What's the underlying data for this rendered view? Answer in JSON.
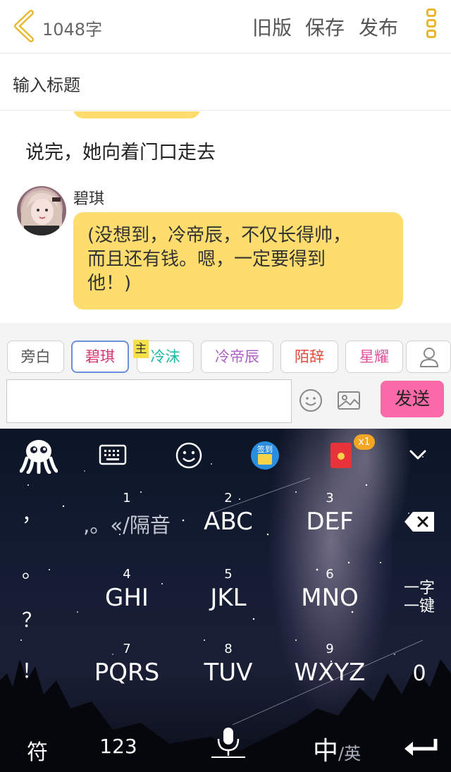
{
  "header": {
    "word_count": "1048字",
    "old_version": "旧版",
    "save": "保存",
    "publish": "发布"
  },
  "title_input": {
    "placeholder": "输入标题"
  },
  "content": {
    "narration": "说完，她向着门口走去",
    "speaker_name": "碧琪",
    "bubble_lines": [
      "(没想到，冷帝辰，不仅长得帅，",
      "而且还有钱。嗯，一定要得到",
      "他！)"
    ]
  },
  "characters": {
    "chips": [
      {
        "label": "旁白",
        "color": "#555555"
      },
      {
        "label": "碧琪",
        "color": "#d6336c"
      },
      {
        "label": "冷沫",
        "color": "#1bb8a5"
      },
      {
        "label": "冷帝辰",
        "color": "#b05fc7"
      },
      {
        "label": "陌辞",
        "color": "#e24b3f"
      },
      {
        "label": "星耀",
        "color": "#e0509b"
      }
    ],
    "main_badge": "主"
  },
  "composer": {
    "send": "发送"
  },
  "keyboard": {
    "toolbar_icons": [
      "octopus-logo-icon",
      "keyboard-icon",
      "emoji-icon",
      "checkin-calendar-icon",
      "red-envelope-icon",
      "chevron-down-icon"
    ],
    "checkin_label": "签到",
    "red_packet_badge": "x1",
    "side_punct": [
      "，",
      "。",
      "？",
      "！"
    ],
    "keys": [
      {
        "num": "1",
        "main": ",。«/隔音"
      },
      {
        "num": "2",
        "main": "ABC"
      },
      {
        "num": "3",
        "main": "DEF"
      },
      {
        "num": "4",
        "main": "GHI"
      },
      {
        "num": "5",
        "main": "JKL"
      },
      {
        "num": "6",
        "main": "MNO"
      },
      {
        "num": "7",
        "main": "PQRS"
      },
      {
        "num": "8",
        "main": "TUV"
      },
      {
        "num": "9",
        "main": "WXYZ"
      }
    ],
    "one_key_line1": "一字",
    "one_key_line2": "一键",
    "zero": "0",
    "symbols": "符",
    "numbers": "123",
    "lang_main": "中",
    "lang_alt": "/英"
  },
  "colors": {
    "accent_yellow": "#fedd6e",
    "send_pink": "#fa6aa8",
    "icon_gold": "#e8b930"
  }
}
